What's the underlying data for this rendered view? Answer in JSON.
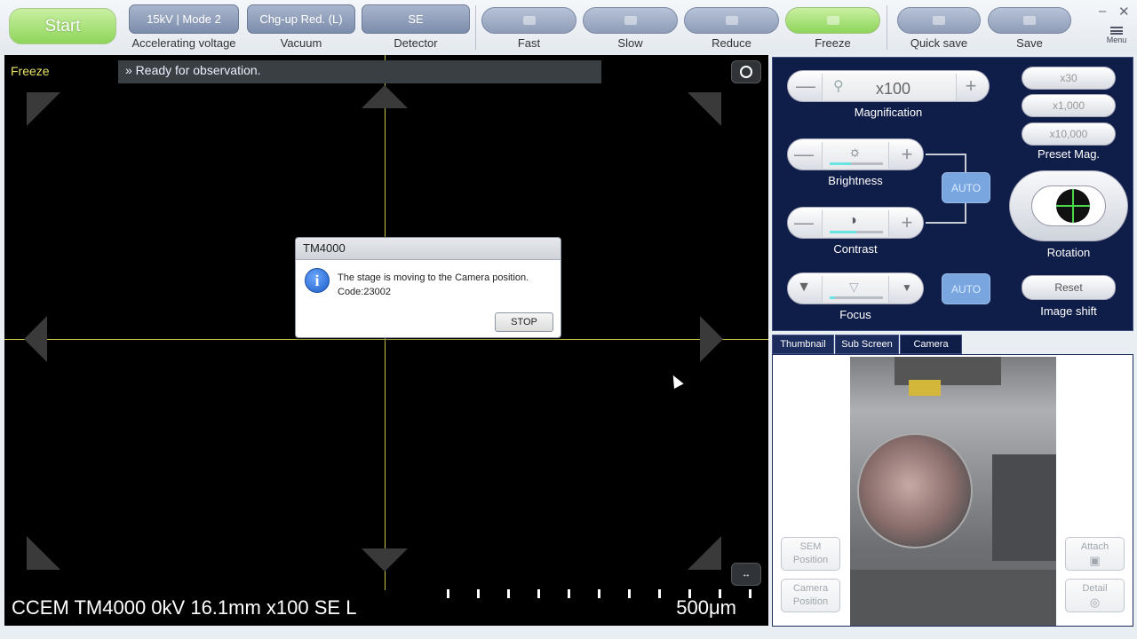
{
  "toolbar": {
    "start_label": "Start",
    "voltage_value": "15kV | Mode 2",
    "voltage_label": "Accelerating voltage",
    "vacuum_value": "Chg-up Red. (L)",
    "vacuum_label": "Vacuum",
    "detector_value": "SE",
    "detector_label": "Detector",
    "fast_label": "Fast",
    "slow_label": "Slow",
    "reduce_label": "Reduce",
    "freeze_label": "Freeze",
    "quick_save_label": "Quick save",
    "save_label": "Save",
    "menu_label": "Menu",
    "minimize_glyph": "–",
    "close_glyph": "✕"
  },
  "viewer": {
    "mode_tag": "Freeze",
    "status": "» Ready for observation.",
    "caption": "CCEM TM4000 0kV 16.1mm x100 SE L",
    "scale": "500μm"
  },
  "dialog": {
    "title": "TM4000",
    "message_line1": "The stage is moving to the Camera position.",
    "message_line2": "Code:23002",
    "stop_label": "STOP"
  },
  "panel": {
    "magnification_value": "x100",
    "magnification_label": "Magnification",
    "preset_values": [
      "x30",
      "x1,000",
      "x10,000"
    ],
    "preset_label": "Preset Mag.",
    "brightness_label": "Brightness",
    "contrast_label": "Contrast",
    "focus_label": "Focus",
    "auto_label": "AUTO",
    "focus_auto_label": "AUTO",
    "rotation_label": "Rotation",
    "reset_label": "Reset",
    "image_shift_label": "Image shift",
    "minus": "—",
    "plus": "+"
  },
  "tabs": [
    "Thumbnail",
    "Sub Screen",
    "Camera"
  ],
  "camera": {
    "sem_position_label": "SEM\nPosition",
    "camera_position_label": "Camera\nPosition",
    "attach_label": "Attach",
    "detail_label": "Detail"
  }
}
